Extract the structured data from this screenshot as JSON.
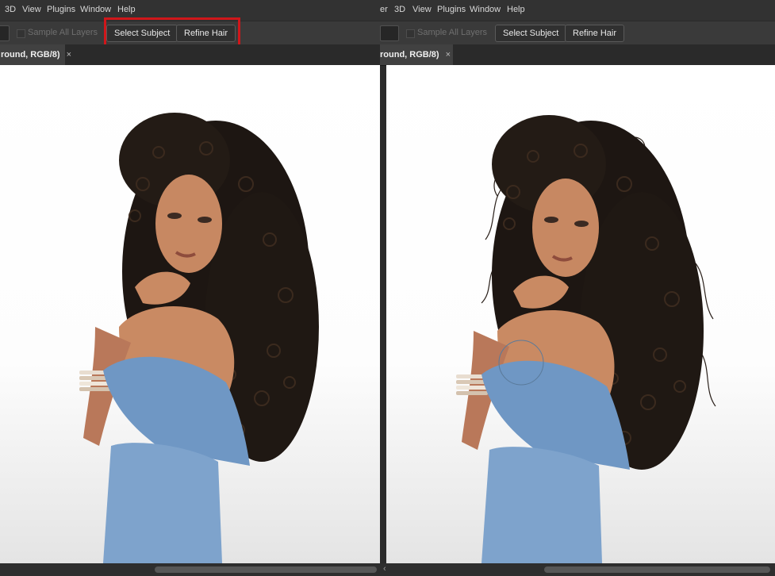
{
  "menus": {
    "left": [
      "3D",
      "View",
      "Plugins",
      "Window",
      "Help"
    ],
    "right_partial": "er",
    "right": [
      "3D",
      "View",
      "Plugins",
      "Window",
      "Help"
    ]
  },
  "options": {
    "sample_all_layers": "Sample All Layers",
    "select_subject": "Select Subject",
    "refine_hair": "Refine Hair"
  },
  "document_tab": {
    "title_fragment": "round, RGB/8)",
    "close": "×"
  },
  "scroll_arrow": "‹",
  "photo": {
    "description_icon": "woman-portrait",
    "colors": {
      "background": "#ffffff",
      "hair": "#1d1612",
      "skin": "#c98a63",
      "denim": "#6f97c4",
      "highlight_box": "#d0161a"
    }
  }
}
